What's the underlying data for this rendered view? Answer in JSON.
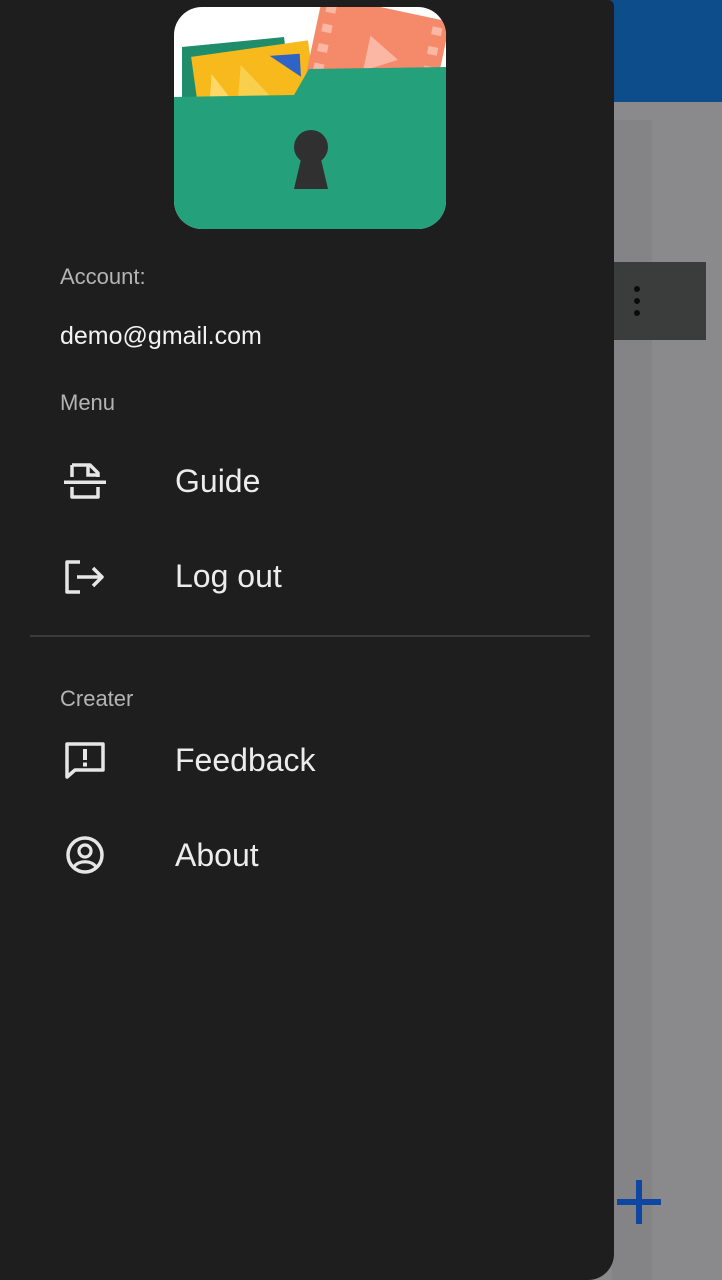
{
  "drawer": {
    "account_label": "Account:",
    "account_email": "demo@gmail.com",
    "menu_section_label": "Menu",
    "menu_items": [
      {
        "label": "Guide",
        "icon": "document-scan-icon"
      },
      {
        "label": "Log out",
        "icon": "logout-icon"
      }
    ],
    "creator_section_label": "Creater",
    "creator_items": [
      {
        "label": "Feedback",
        "icon": "feedback-icon"
      },
      {
        "label": "About",
        "icon": "account-circle-icon"
      }
    ]
  },
  "colors": {
    "drawer_background": "#1d1e1d",
    "scrim": "#7b7b7d",
    "app_bar": "#0d4d8c",
    "logo_folder": "#24a07a",
    "logo_photo": "#f7b91c",
    "logo_film": "#f58a6b",
    "fab_icon": "#0d47a1"
  }
}
